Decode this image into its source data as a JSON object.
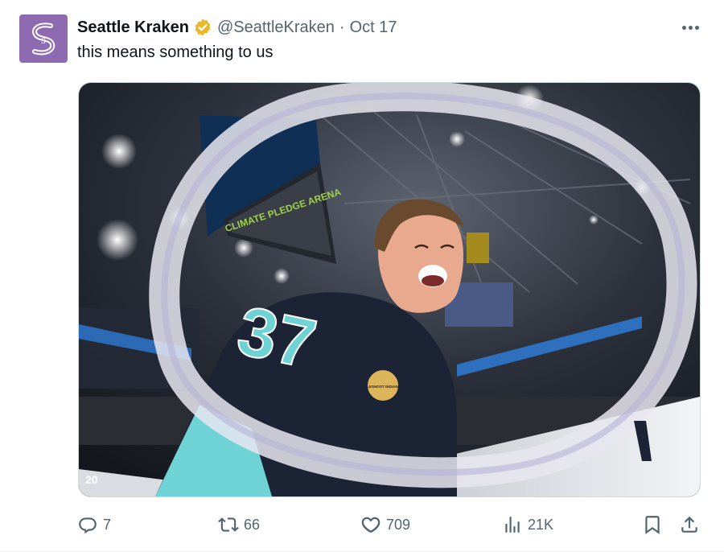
{
  "tweet": {
    "author_name": "Seattle Kraken",
    "handle": "@SeattleKraken",
    "separator": "·",
    "date": "Oct 17",
    "text": "this means something to us",
    "avatar_glyph": "S"
  },
  "image": {
    "scoreboard_sign": "CLIMATE PLEDGE ARENA",
    "jersey_number": "37",
    "patch_text": "MUCKLESHOOT INDIAN TRIBE",
    "board_number": "20"
  },
  "actions": {
    "replies": "7",
    "reposts": "66",
    "likes": "709",
    "views": "21K"
  },
  "colors": {
    "brand_purple": "#8e6bb0",
    "verified_gold": "#e8b829",
    "muted_text": "#536471",
    "ice_blue": "#6fd3d6",
    "jersey_navy": "#1c2334"
  },
  "icons": [
    "seattle-kraken-logo-icon",
    "verified-badge-icon",
    "more-icon",
    "reply-icon",
    "repost-icon",
    "like-icon",
    "views-icon",
    "bookmark-icon",
    "share-icon"
  ]
}
